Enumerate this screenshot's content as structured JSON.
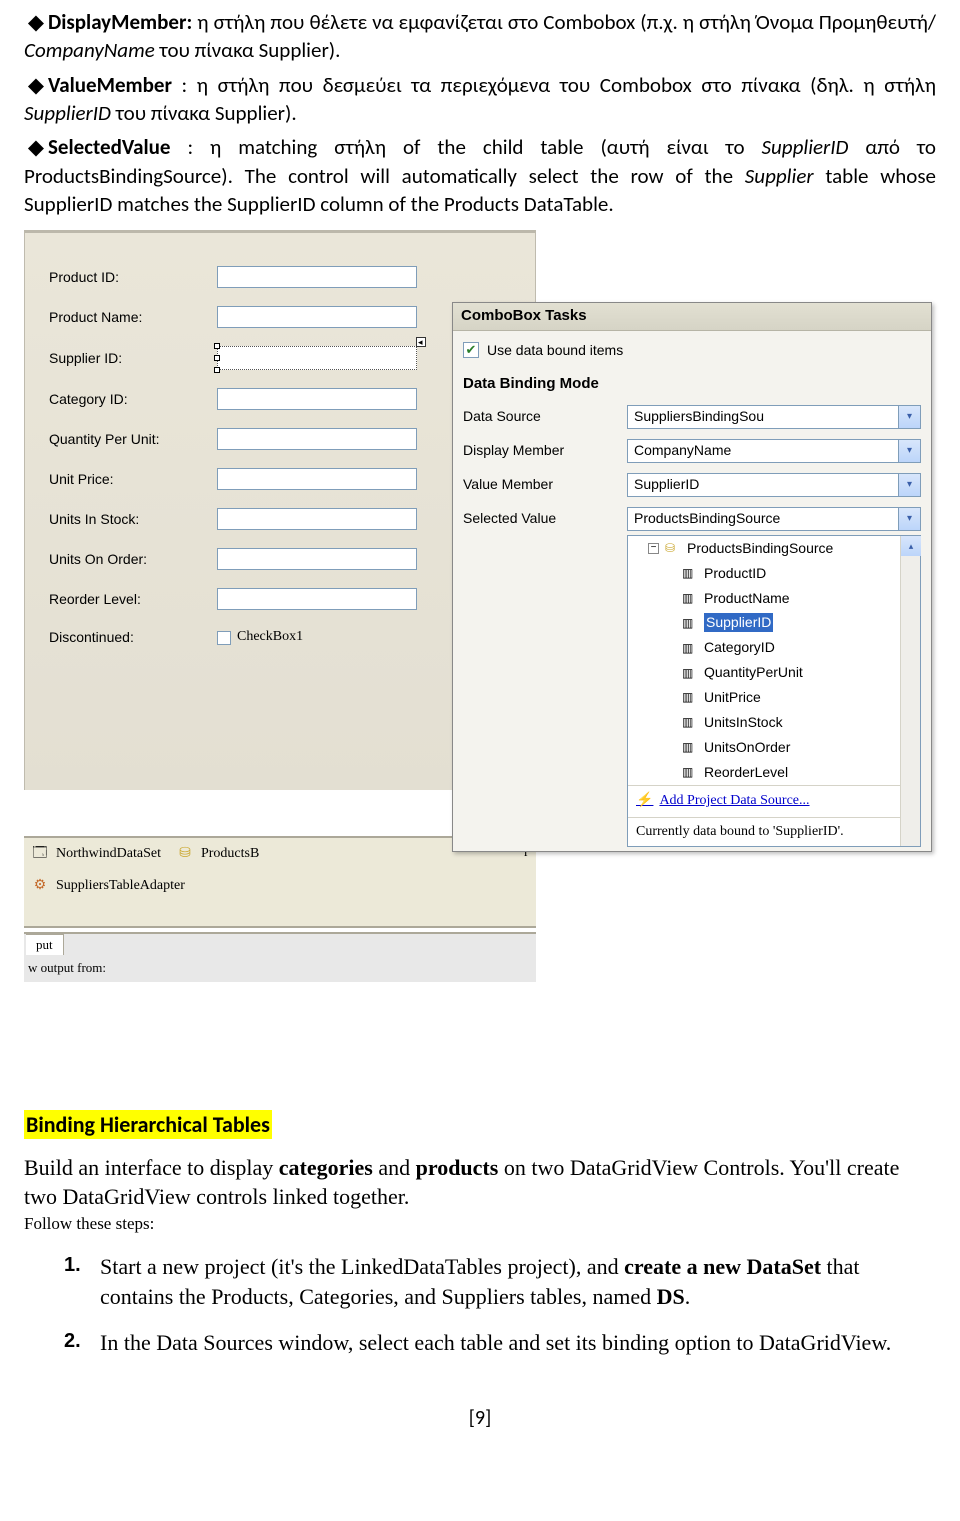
{
  "text": {
    "p1a": "DisplayMember:",
    "p1b": " η στήλη που θέλετε να εμφανίζεται στο Combobox (π.χ. η στήλη Όνομα Προμηθευτή/ ",
    "p1c": "CompanyName",
    "p1d": " του πίνακα Supplier).",
    "p2a": "ValueMember",
    "p2b": " : η στήλη που δεσμεύει τα περιεχόμενα του Combobox στο πίνακα (δηλ. η στήλη ",
    "p2c": "SupplierID",
    "p2d": " του πίνακα Supplier).",
    "p3a": "SelectedValue",
    "p3b": " : η matching στήλη of the child table (αυτή είναι το ",
    "p3c": "SupplierID",
    "p3d": " από το ProductsBindingSource). The control will automatically select the row of the ",
    "p3e": "Supplier",
    "p3f": " table whose SupplierID matches the SupplierID column of the Products DataTable.",
    "sectionTitle": "Binding Hierarchical Tables",
    "build1": "Build an interface to display ",
    "build2": "categories",
    "build3": " and ",
    "build4": "products",
    "build5": " on two DataGridView Controls. You'll create two DataGridView controls linked together.",
    "follow": "Follow these steps:",
    "step1a": "Start a new project (it's the LinkedDataTables project), and ",
    "step1b": "create a new DataSet",
    "step1c": " that contains the Products, Categories, and Suppliers tables, named ",
    "step1d": "DS",
    "step1e": ".",
    "step2": "In the Data Sources window, select each table and set its binding option to DataGridView.",
    "pageNum": "[9]"
  },
  "form": {
    "labels": {
      "productId": "Product ID:",
      "productName": "Product Name:",
      "supplierId": "Supplier ID:",
      "categoryId": "Category ID:",
      "qpu": "Quantity Per Unit:",
      "unitPrice": "Unit Price:",
      "unitsInStock": "Units In Stock:",
      "unitsOnOrder": "Units On Order:",
      "reorderLevel": "Reorder Level:",
      "discontinued": "Discontinued:"
    },
    "checkboxLabel": "CheckBox1"
  },
  "tray": {
    "item1": "NorthwindDataSet",
    "item2": "ProductsB",
    "item3": "r",
    "item4": "SuppliersTableAdapter"
  },
  "output": {
    "tab": "put",
    "line": "w output from:"
  },
  "smart": {
    "title": "ComboBox Tasks",
    "useBound": "Use data bound items",
    "mode": "Data Binding Mode",
    "labels": {
      "dataSource": "Data Source",
      "displayMember": "Display Member",
      "valueMember": "Value Member",
      "selectedValue": "Selected Value"
    },
    "values": {
      "dataSource": "SuppliersBindingSou",
      "displayMember": "CompanyName",
      "valueMember": "SupplierID",
      "selectedValue": "ProductsBindingSource"
    },
    "tree": {
      "root": "ProductsBindingSource",
      "items": [
        "ProductID",
        "ProductName",
        "SupplierID",
        "CategoryID",
        "QuantityPerUnit",
        "UnitPrice",
        "UnitsInStock",
        "UnitsOnOrder",
        "ReorderLevel"
      ],
      "selectedIndex": 2,
      "addLink": "Add Project Data Source...",
      "status": "Currently data bound to 'SupplierID'."
    }
  }
}
